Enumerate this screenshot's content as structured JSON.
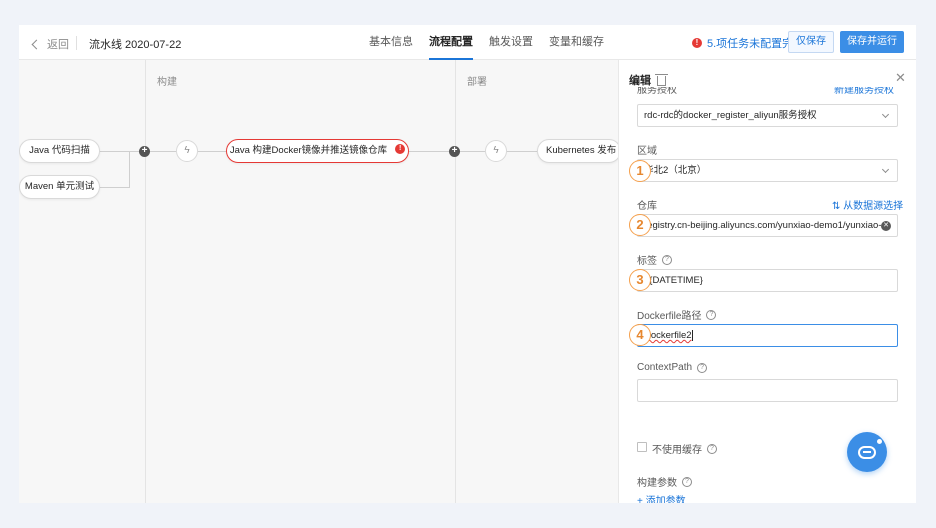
{
  "header": {
    "back_label": "返回",
    "pipeline_title": "流水线 2020-07-22",
    "tabs": [
      {
        "label": "基本信息"
      },
      {
        "label": "流程配置"
      },
      {
        "label": "触发设置"
      },
      {
        "label": "变量和缓存"
      }
    ],
    "warning_text": "5.项任务未配置完",
    "save_label": "仅保存",
    "run_label": "保存并运行"
  },
  "canvas": {
    "stages": [
      {
        "title": "构建"
      },
      {
        "title": "部署"
      }
    ],
    "sources": [
      {
        "label": "Java 代码扫描"
      },
      {
        "label": "Maven 单元测试"
      }
    ],
    "build_task": "Java 构建Docker镜像并推送镜像仓库",
    "deploy_task": "Kubernetes 发布"
  },
  "panel": {
    "title": "编辑",
    "service_auth_label": "服务授权",
    "service_auth_link": "新建服务授权",
    "service_auth_value": "rdc-rdc的docker_register_aliyun服务授权",
    "region_label": "区域",
    "region_value": "华北2（北京）",
    "repo_label": "仓库",
    "repo_link": "⇅ 从数据源选择",
    "repo_value": "registry.cn-beijing.aliyuncs.com/yunxiao-demo1/yunxiao-",
    "tag_label": "标签",
    "tag_value": "${DATETIME}",
    "dockerfile_label": "Dockerfile路径",
    "dockerfile_value": "Dockerfile2",
    "context_label": "ContextPath",
    "context_value": "",
    "no_cache_label": "不使用缓存",
    "build_args_label": "构建参数",
    "add_param_label": "+ 添加参数"
  },
  "callouts": [
    "1",
    "2",
    "3",
    "4"
  ],
  "colors": {
    "accent": "#1b75d8",
    "primary_button": "#3b8ee6",
    "error": "#e53935",
    "callout": "#f5a04d"
  }
}
